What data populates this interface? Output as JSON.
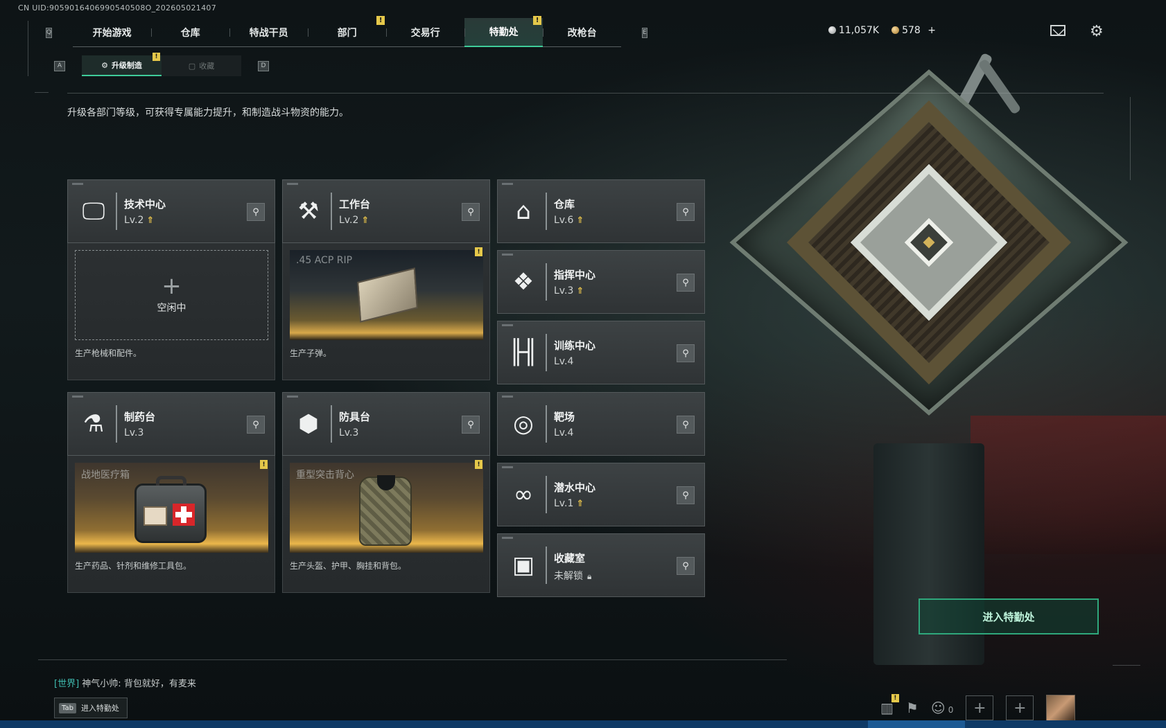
{
  "header": {
    "uid": "CN UID:9059016406990540508O_202605021407",
    "nav_left_key": "Q",
    "nav_right_key": "E",
    "tabs": [
      {
        "label": "开始游戏",
        "alert": false,
        "active": false
      },
      {
        "label": "仓库",
        "alert": false,
        "active": false
      },
      {
        "label": "特战干员",
        "alert": false,
        "active": false
      },
      {
        "label": "部门",
        "alert": true,
        "active": false
      },
      {
        "label": "交易行",
        "alert": false,
        "active": false
      },
      {
        "label": "特勤处",
        "alert": true,
        "active": true
      },
      {
        "label": "改枪台",
        "alert": false,
        "active": false
      }
    ],
    "alert_symbol": "!",
    "currency_silver": "11,057K",
    "currency_gold": "578",
    "gold_add": "+",
    "icons": [
      "mail-icon",
      "gear-icon"
    ]
  },
  "subtabs": {
    "left_key": "A",
    "right_key": "D",
    "items": [
      {
        "label": "升级制造",
        "active": true,
        "icon": "upgrade-icon"
      },
      {
        "label": "收藏",
        "active": false,
        "icon": "collection-icon"
      }
    ]
  },
  "intro": "升级各部门等级，可获得专属能力提升，和制造战斗物资的能力。",
  "facilities": {
    "tech_center": {
      "name": "技术中心",
      "level": "Lv.2",
      "upgradable": true,
      "icon": "monitor-icon"
    },
    "workbench": {
      "name": "工作台",
      "level": "Lv.2",
      "upgradable": true,
      "icon": "hammer-wrench-icon"
    },
    "pharmacy": {
      "name": "制药台",
      "level": "Lv.3",
      "upgradable": false,
      "icon": "microscope-icon"
    },
    "armor_bench": {
      "name": "防具台",
      "level": "Lv.3",
      "upgradable": false,
      "icon": "blocks-icon"
    },
    "warehouse": {
      "name": "仓库",
      "level": "Lv.6",
      "upgradable": true,
      "icon": "warehouse-icon"
    },
    "command_center": {
      "name": "指挥中心",
      "level": "Lv.3",
      "upgradable": true,
      "icon": "command-chip-icon"
    },
    "training_center": {
      "name": "训练中心",
      "level": "Lv.4",
      "upgradable": false,
      "icon": "dumbbell-icon"
    },
    "range": {
      "name": "靶场",
      "level": "Lv.4",
      "upgradable": false,
      "icon": "target-icon"
    },
    "diving_center": {
      "name": "潜水中心",
      "level": "Lv.1",
      "upgradable": true,
      "icon": "diving-mask-icon"
    },
    "collection_room": {
      "name": "收藏室",
      "level": "未解锁",
      "locked": true,
      "icon": "vault-icon"
    }
  },
  "production": {
    "tech_center": {
      "idle_text": "空闲中",
      "plus": "+",
      "desc": "生产枪械和配件。"
    },
    "workbench": {
      "item_name": ".45 ACP RIP",
      "desc": "生产子弹。",
      "alert": true
    },
    "pharmacy": {
      "item_name": "战地医疗箱",
      "desc": "生产药品、针剂和维修工具包。",
      "alert": true
    },
    "armor_bench": {
      "item_name": "重型突击背心",
      "desc": "生产头盔、护甲、胸挂和背包。",
      "alert": true
    }
  },
  "enter_button": "进入特勤处",
  "chat": {
    "channel": "[世界]",
    "speaker": "神气小帅:",
    "message": "背包就好，有麦来"
  },
  "tab_hint": {
    "key": "Tab",
    "label": "进入特勤处"
  },
  "bottom_tools": {
    "friends_count": "0",
    "icons": [
      "stats-icon",
      "flag-icon",
      "friends-icon",
      "add-slot-icon",
      "add-slot-icon",
      "avatar"
    ]
  },
  "colors": {
    "accent_green": "#3fcc9a",
    "alert_yellow": "#e5c84a",
    "upgrade_gold": "#e7c24a"
  }
}
